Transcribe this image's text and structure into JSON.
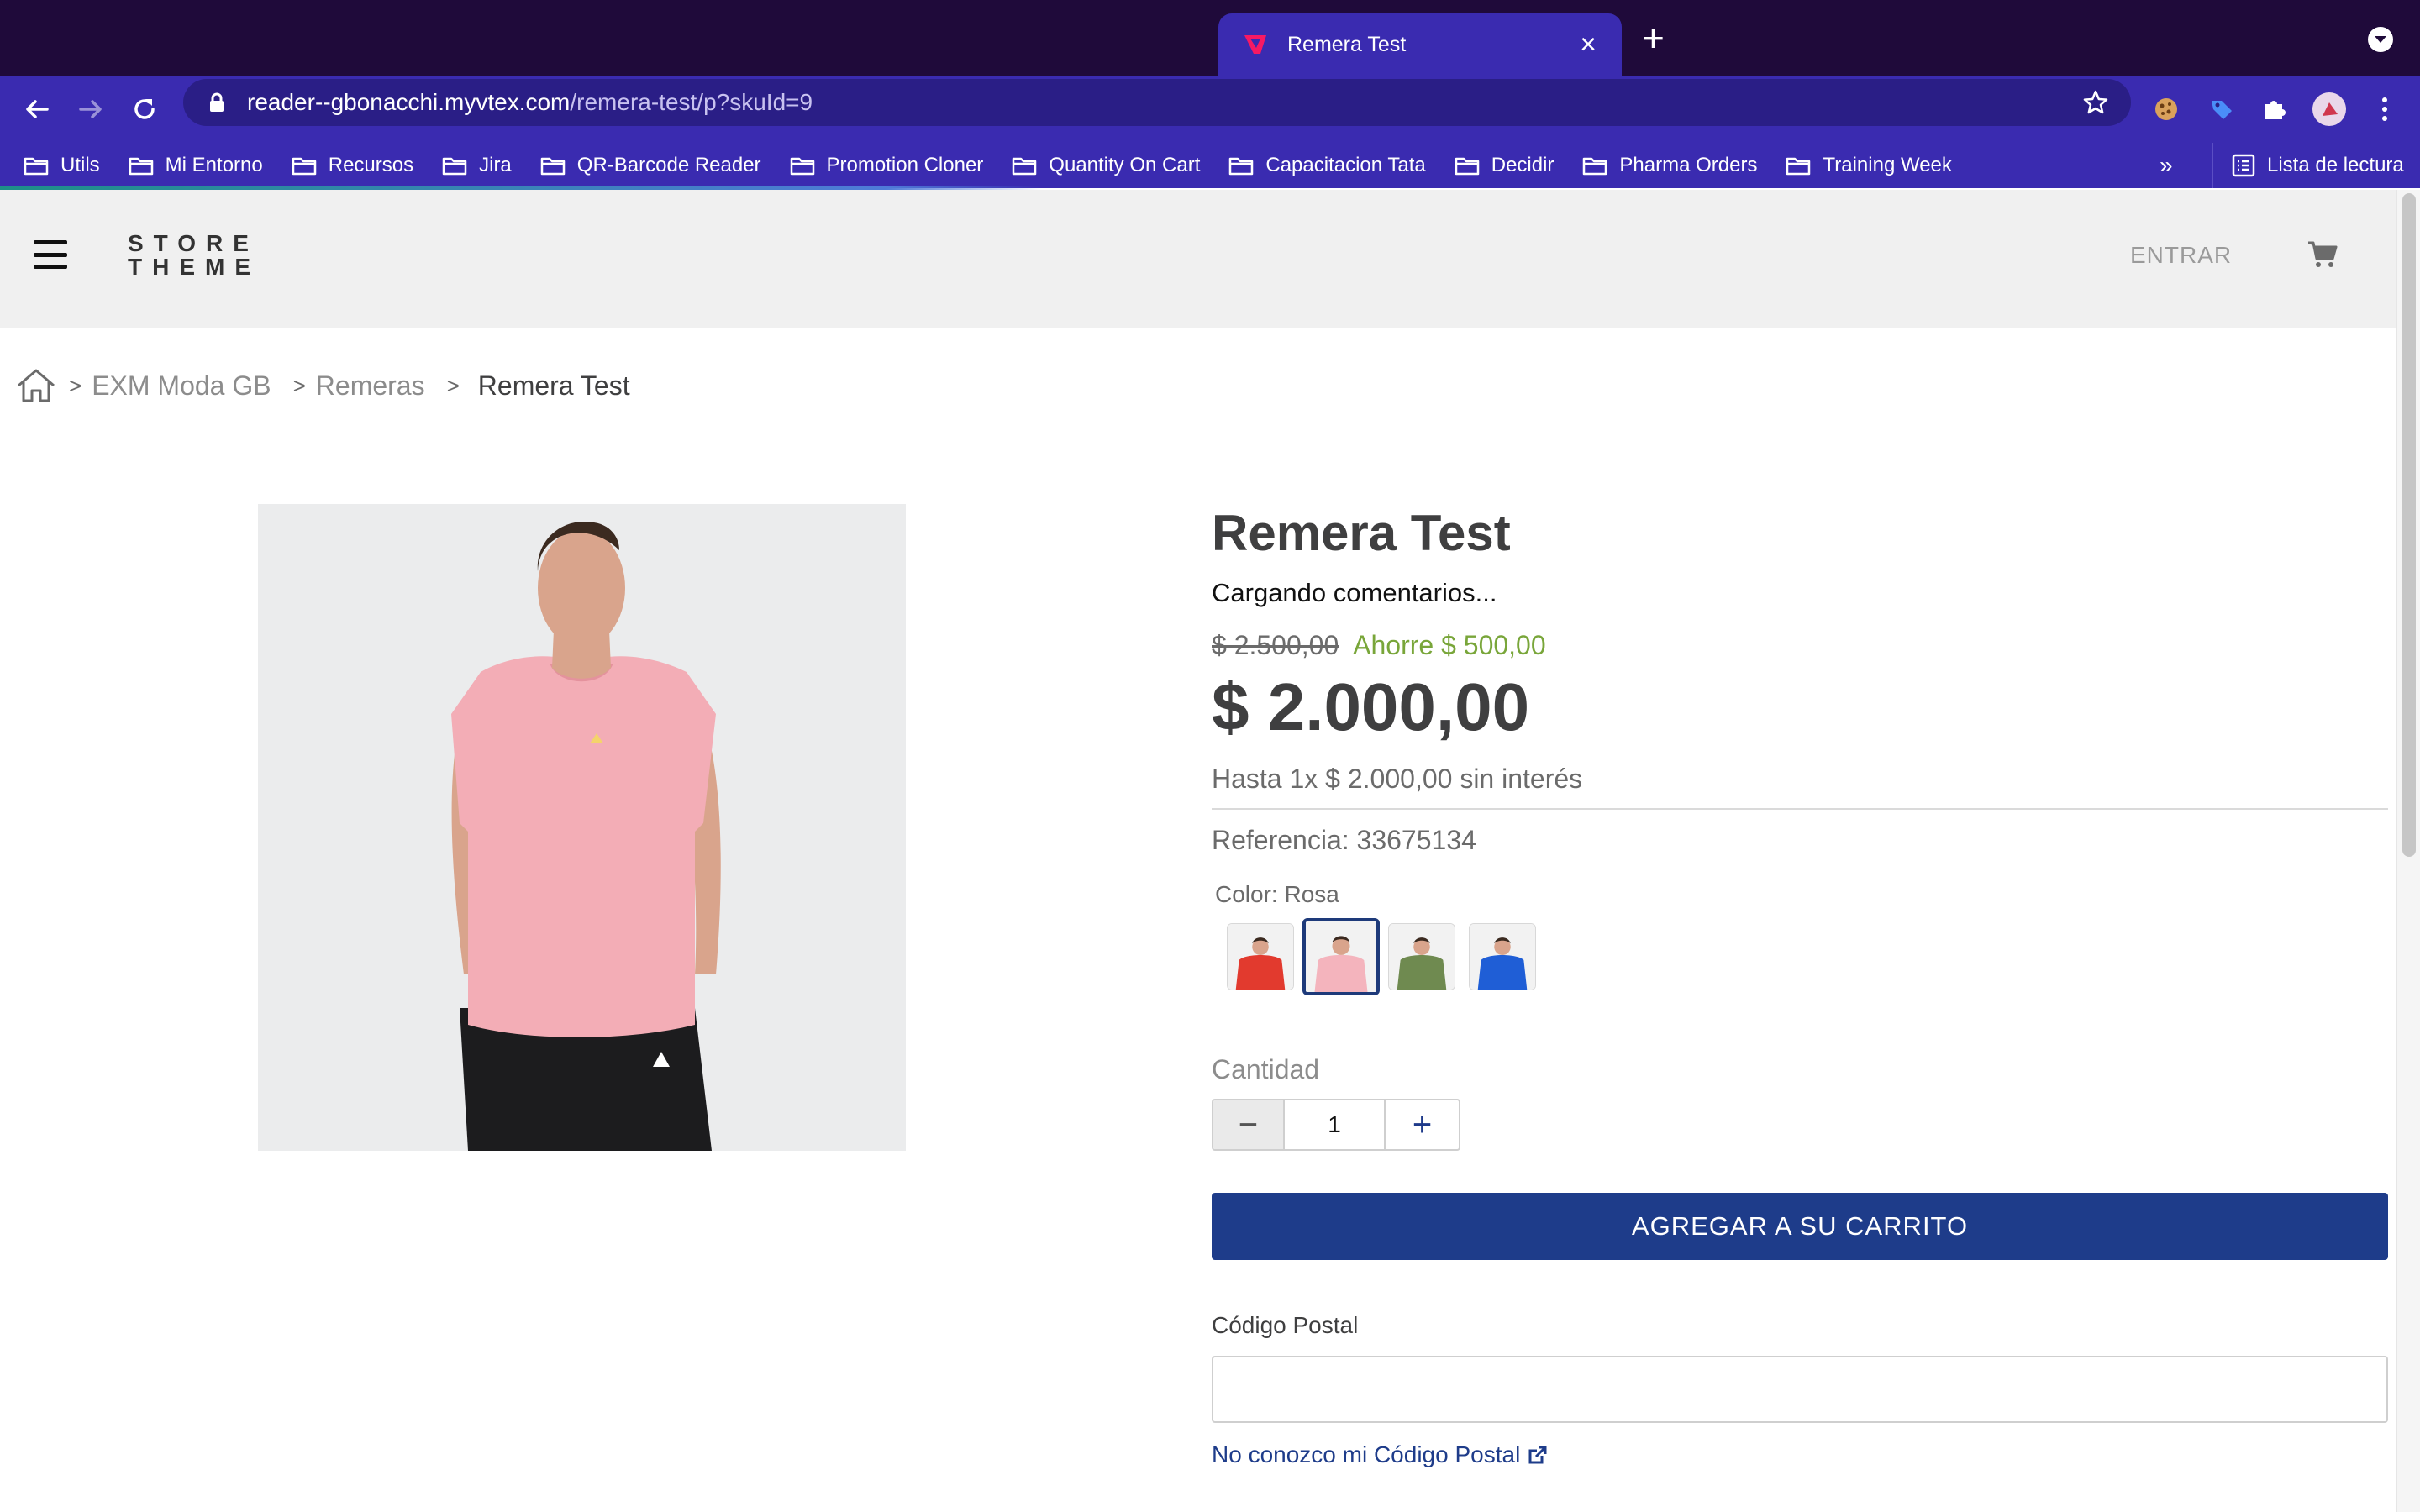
{
  "browser": {
    "tab_title": "Remera Test",
    "tab_close": "×",
    "new_tab": "+",
    "url_host": "reader--gbonacchi.myvtex.com",
    "url_path": "/remera-test/p?skuId=9",
    "bookmarks": [
      {
        "label": "Utils"
      },
      {
        "label": "Mi Entorno"
      },
      {
        "label": "Recursos"
      },
      {
        "label": "Jira"
      },
      {
        "label": "QR-Barcode Reader"
      },
      {
        "label": "Promotion Cloner"
      },
      {
        "label": "Quantity On Cart"
      },
      {
        "label": "Capacitacion Tata"
      },
      {
        "label": "Decidir"
      },
      {
        "label": "Pharma Orders"
      },
      {
        "label": "Training Week"
      }
    ],
    "bookmarks_more": "»",
    "reading_list": "Lista de lectura"
  },
  "header": {
    "logo_line1": "STORE",
    "logo_line2": "THEME",
    "login_label": "ENTRAR"
  },
  "breadcrumb": {
    "items": [
      "EXM Moda GB",
      "Remeras"
    ],
    "current": "Remera Test",
    "separator": ">"
  },
  "product": {
    "name": "Remera Test",
    "comments_status": "Cargando comentarios...",
    "list_price": "$ 2.500,00",
    "savings": "Ahorre $ 500,00",
    "selling_price": "$ 2.000,00",
    "installments": "Hasta 1x $ 2.000,00 sin interés",
    "reference": "Referencia: 33675134",
    "color_label": "Color: Rosa",
    "swatches": [
      {
        "color": "#e23a2e",
        "selected": false
      },
      {
        "color": "#f4b4bd",
        "selected": true
      },
      {
        "color": "#6f8a50",
        "selected": false
      },
      {
        "color": "#1f5ed6",
        "selected": false
      }
    ],
    "quantity_label": "Cantidad",
    "quantity_value": "1",
    "minus": "−",
    "plus": "+",
    "add_to_cart": "AGREGAR A SU CARRITO",
    "postal_label": "Código Postal",
    "postal_value": "",
    "postal_link": "No conozco mi Código Postal"
  },
  "colors": {
    "brand_dark": "#1e3c8a",
    "savings_green": "#79a63a",
    "chrome_purple": "#3a2bb0",
    "chrome_dark": "#1f0a3a"
  }
}
